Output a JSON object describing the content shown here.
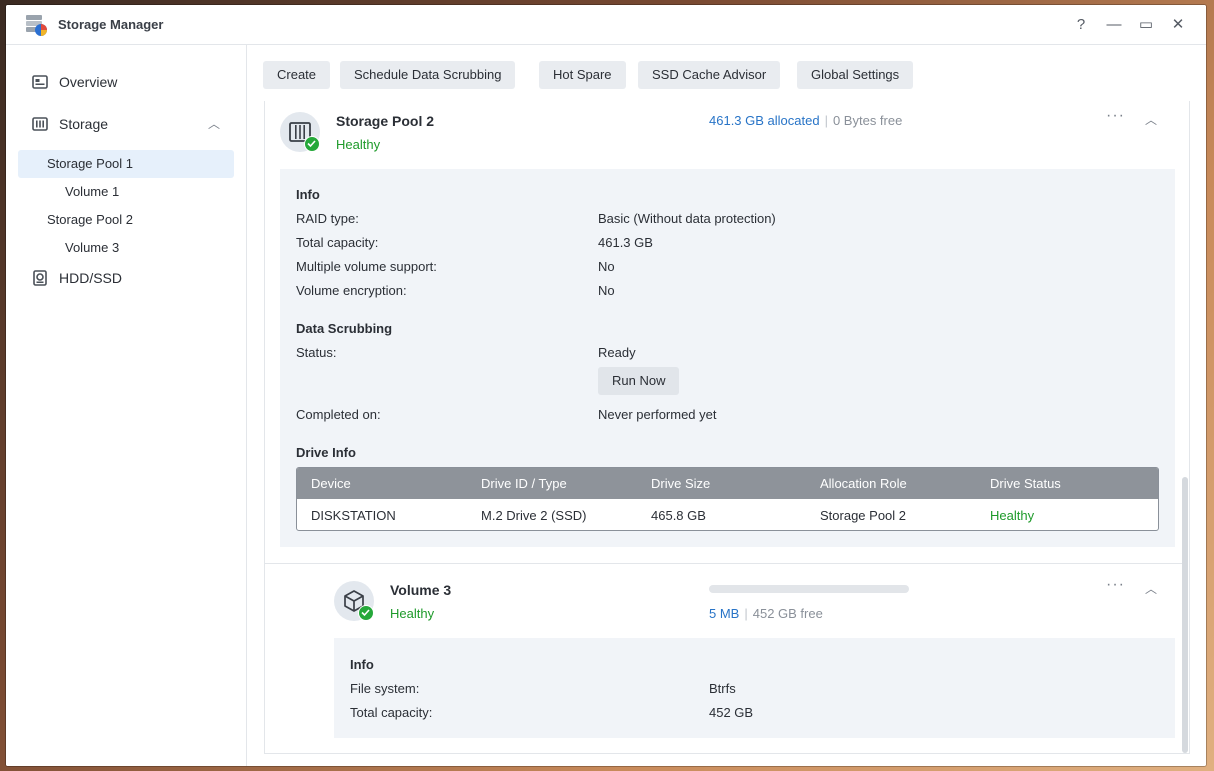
{
  "window": {
    "title": "Storage Manager",
    "controls": {
      "help": "?",
      "minimize": "—",
      "maximize": "▭",
      "close": "✕"
    }
  },
  "sidebar": {
    "items": [
      {
        "label": "Overview",
        "icon": "overview-icon"
      },
      {
        "label": "Storage",
        "icon": "storage-icon",
        "expanded": true
      },
      {
        "label": "HDD/SSD",
        "icon": "disk-icon"
      }
    ],
    "tree": [
      {
        "label": "Storage Pool 1",
        "active": true
      },
      {
        "label": "Volume 1"
      },
      {
        "label": "Storage Pool 2"
      },
      {
        "label": "Volume 3"
      }
    ]
  },
  "toolbar": {
    "buttons": [
      "Create",
      "Schedule Data Scrubbing",
      "Hot Spare",
      "SSD Cache Advisor",
      "Global Settings"
    ]
  },
  "pool": {
    "name": "Storage Pool 2",
    "status": "Healthy",
    "allocated": "461.3 GB allocated",
    "free": "0 Bytes free",
    "info": {
      "title": "Info",
      "rows": [
        {
          "label": "RAID type:",
          "value": "Basic (Without data protection)"
        },
        {
          "label": "Total capacity:",
          "value": "461.3 GB"
        },
        {
          "label": "Multiple volume support:",
          "value": "No"
        },
        {
          "label": "Volume encryption:",
          "value": "No"
        }
      ]
    },
    "scrubbing": {
      "title": "Data Scrubbing",
      "status_label": "Status:",
      "status_value": "Ready",
      "run_button": "Run Now",
      "completed_label": "Completed on:",
      "completed_value": "Never performed yet"
    },
    "drive_info": {
      "title": "Drive Info",
      "columns": [
        "Device",
        "Drive ID / Type",
        "Drive Size",
        "Allocation Role",
        "Drive Status"
      ],
      "rows": [
        [
          "DISKSTATION",
          "M.2 Drive 2 (SSD)",
          "465.8 GB",
          "Storage Pool 2",
          "Healthy"
        ]
      ]
    }
  },
  "volume": {
    "name": "Volume 3",
    "status": "Healthy",
    "used": "5 MB",
    "free": "452 GB free",
    "usage_fraction": 0.0,
    "info": {
      "title": "Info",
      "rows": [
        {
          "label": "File system:",
          "value": "Btrfs"
        },
        {
          "label": "Total capacity:",
          "value": "452 GB"
        }
      ]
    }
  },
  "colors": {
    "accent": "#2874c7",
    "healthy": "#1e9a2a",
    "active_bg": "#e6f0fb"
  }
}
